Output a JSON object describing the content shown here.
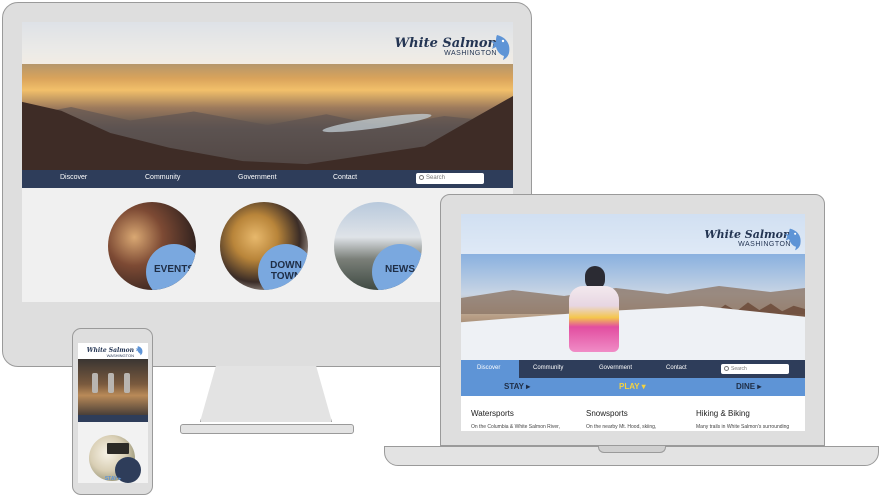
{
  "brand": {
    "name": "White Salmon",
    "state": "WASHINGTON"
  },
  "colors": {
    "navy": "#2e3d5a",
    "accent_blue": "#5e94d6",
    "bubble_blue": "#7aa8df",
    "highlight_yellow": "#f4d23f"
  },
  "desktop": {
    "nav": [
      "Discover",
      "Community",
      "Government",
      "Contact"
    ],
    "search_placeholder": "Search",
    "circles": [
      {
        "label_line1": "EVENTS",
        "label_line2": ""
      },
      {
        "label_line1": "DOWN",
        "label_line2": "TOWN"
      },
      {
        "label_line1": "NEWS",
        "label_line2": ""
      }
    ]
  },
  "laptop": {
    "nav": [
      "Discover",
      "Community",
      "Government",
      "Contact"
    ],
    "active_nav": "Discover",
    "search_placeholder": "Search",
    "subnav": [
      "STAY ▸",
      "PLAY ▾",
      "DINE ▸"
    ],
    "active_subnav": "PLAY",
    "columns": [
      {
        "heading": "Watersports",
        "text": "On the Columbia & White Salmon River,"
      },
      {
        "heading": "Snowsports",
        "text": "On the nearby Mt. Hood, skiing,"
      },
      {
        "heading": "Hiking & Biking",
        "text": "Many trails in White Salmon's surrounding"
      }
    ]
  },
  "phone": {
    "stay_label": "STAY ▸"
  }
}
